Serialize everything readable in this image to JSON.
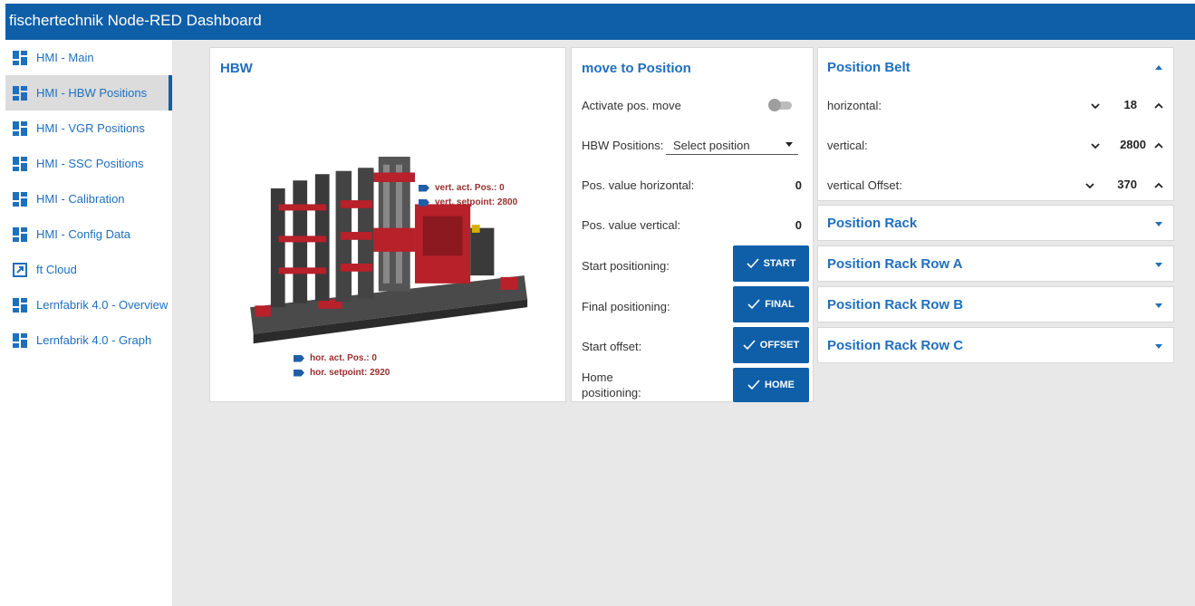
{
  "app": {
    "title": "fischertechnik Node-RED Dashboard"
  },
  "sidebar": {
    "items": [
      {
        "label": "HMI - Main",
        "icon": "dashboard-icon",
        "active": false
      },
      {
        "label": "HMI - HBW Positions",
        "icon": "dashboard-icon",
        "active": true
      },
      {
        "label": "HMI - VGR Positions",
        "icon": "dashboard-icon",
        "active": false
      },
      {
        "label": "HMI - SSC Positions",
        "icon": "dashboard-icon",
        "active": false
      },
      {
        "label": "HMI - Calibration",
        "icon": "dashboard-icon",
        "active": false
      },
      {
        "label": "HMI - Config Data",
        "icon": "dashboard-icon",
        "active": false
      },
      {
        "label": "ft Cloud",
        "icon": "open-in-new-icon",
        "active": false
      },
      {
        "label": "Lernfabrik 4.0 - Overview",
        "icon": "dashboard-icon",
        "active": false
      },
      {
        "label": "Lernfabrik 4.0 - Graph",
        "icon": "dashboard-icon",
        "active": false
      }
    ]
  },
  "hbw": {
    "title": "HBW",
    "vert_act_pos": "vert. act. Pos.: 0",
    "vert_setpoint": "vert. setpoint: 2800",
    "hor_act_pos": "hor. act. Pos.: 0",
    "hor_setpoint": "hor. setpoint: 2920"
  },
  "move": {
    "title": "move to Position",
    "activate_label": "Activate pos. move",
    "activate_on": false,
    "positions_label": "HBW Positions:",
    "positions_placeholder": "Select position",
    "pos_h_label": "Pos. value horizontal:",
    "pos_h_value": "0",
    "pos_v_label": "Pos. value vertical:",
    "pos_v_value": "0",
    "start_label": "Start positioning:",
    "start_btn": "START",
    "final_label": "Final positioning:",
    "final_btn": "FINAL",
    "offset_label": "Start offset:",
    "offset_btn": "OFFSET",
    "home_label_1": "Home",
    "home_label_2": "positioning:",
    "home_btn": "HOME"
  },
  "belt": {
    "title": "Position Belt",
    "horizontal_label": "horizontal:",
    "horizontal_value": "18",
    "vertical_label": "vertical:",
    "vertical_value": "2800",
    "offset_label": "vertical Offset:",
    "offset_value": "370"
  },
  "accordions": [
    {
      "title": "Position Rack"
    },
    {
      "title": "Position Rack Row A"
    },
    {
      "title": "Position Rack Row B"
    },
    {
      "title": "Position Rack Row C"
    }
  ],
  "colors": {
    "primary": "#0f5fa8",
    "link": "#1f6fbf",
    "annotation": "#9a2d2d",
    "machine_red": "#b8202a"
  }
}
